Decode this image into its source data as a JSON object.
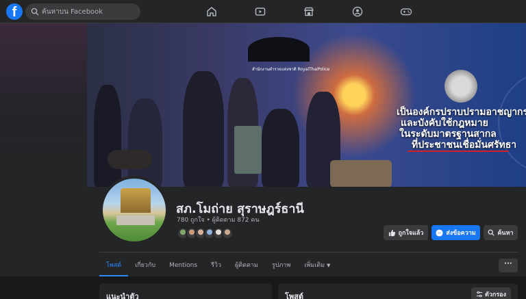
{
  "topbar": {
    "logo": "f",
    "search_placeholder": "ค้นหาบน Facebook",
    "nav_icons": [
      "home-icon",
      "watch-icon",
      "marketplace-icon",
      "groups-icon",
      "gaming-icon"
    ]
  },
  "cover": {
    "subtitle": "สำนักงานตำรวจแห่งชาติ  RoyalThaiPolice",
    "slogan": [
      "เป็นองค์กรปราบปรามอาชญากรรม",
      "และบังคับใช้กฎหมาย",
      "ในระดับมาตรฐานสากล",
      "ที่ประชาชนเชื่อมั่นศรัทธา"
    ]
  },
  "profile": {
    "name": "สภ.โมถ่าย สุราษฎร์ธานี",
    "stats": "780 ถูกใจ • ผู้ติดตาม 872 คน",
    "friend_colors": [
      "#7fa86a",
      "#c79c7d",
      "#d6b19a",
      "#8fb0d8",
      "#e8e0d8",
      "#c9a88d"
    ]
  },
  "actions": {
    "like_label": "ถูกใจแล้ว",
    "message_label": "ส่งข้อความ",
    "search_label": "ค้นหา"
  },
  "tabs": [
    "โพสต์",
    "เกี่ยวกับ",
    "Mentions",
    "รีวิว",
    "ผู้ติดตาม",
    "รูปภาพ",
    "เพิ่มเติม"
  ],
  "more_label": "···",
  "cards": {
    "intro_title": "แนะนำตัว",
    "posts_title": "โพสต์",
    "filter_label": "ตัวกรอง"
  },
  "colors": {
    "accent": "#1877f2",
    "active_tab": "#2d88ff",
    "background": "#18191a",
    "surface": "#242526"
  }
}
